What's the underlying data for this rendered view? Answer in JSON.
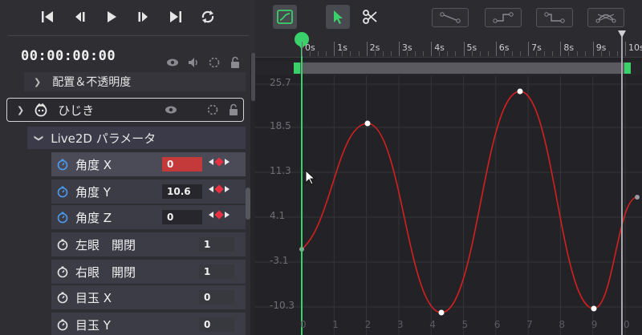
{
  "transport": {
    "buttons": [
      {
        "name": "skip-to-start-button",
        "icon": "skip-start-icon"
      },
      {
        "name": "prev-frame-button",
        "icon": "step-back-icon"
      },
      {
        "name": "play-button",
        "icon": "play-icon"
      },
      {
        "name": "next-frame-button",
        "icon": "step-forward-icon"
      },
      {
        "name": "skip-to-end-button",
        "icon": "skip-end-icon"
      },
      {
        "name": "loop-button",
        "icon": "loop-icon"
      }
    ]
  },
  "timecode": "00:00:00:00",
  "tree": {
    "placement_label": "配置＆不透明度",
    "object_label": "ひじき",
    "group_label": "Live2D パラメータ"
  },
  "params": [
    {
      "label": "角度 X",
      "value": "0",
      "has_keyframes": true
    },
    {
      "label": "角度 Y",
      "value": "10.6",
      "has_keyframes": true
    },
    {
      "label": "角度 Z",
      "value": "0",
      "has_keyframes": true
    },
    {
      "label": "左眼　開閉",
      "value": "1",
      "has_keyframes": false
    },
    {
      "label": "右眼　開閉",
      "value": "1",
      "has_keyframes": false
    },
    {
      "label": "目玉 X",
      "value": "0",
      "has_keyframes": false
    },
    {
      "label": "目玉 Y",
      "value": "0",
      "has_keyframes": false
    }
  ],
  "ruler": {
    "labels": [
      "0s",
      "1s",
      "2s",
      "3s",
      "4s",
      "5s",
      "6s",
      "7s",
      "8s",
      "9s",
      "10s"
    ]
  },
  "graph": {
    "value_labels": [
      "25.7",
      "18.5",
      "11.3",
      "4.1",
      "-3.1",
      "-10.3"
    ],
    "frame_labels": [
      "0",
      "1",
      "2",
      "3",
      "4",
      "5",
      "6",
      "7",
      "8",
      "9",
      "0"
    ]
  },
  "colors": {
    "playhead": "#3ad06a",
    "curve": "#d42020",
    "accent_select": "#3ad06a"
  }
}
